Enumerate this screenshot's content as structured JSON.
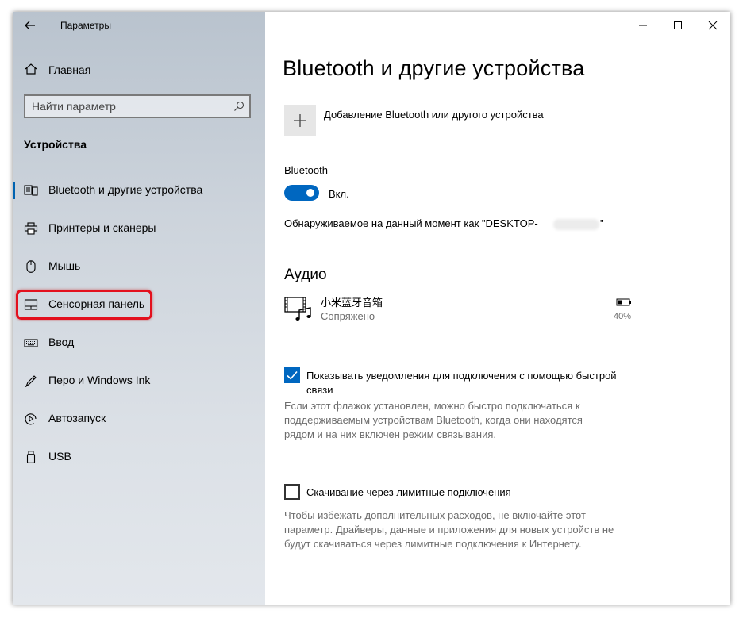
{
  "window": {
    "title": "Параметры"
  },
  "sidebar": {
    "home_label": "Главная",
    "search_placeholder": "Найти параметр",
    "section_title": "Устройства",
    "items": [
      {
        "label": "Bluetooth и другие устройства",
        "icon": "bluetooth-devices-icon",
        "selected": true
      },
      {
        "label": "Принтеры и сканеры",
        "icon": "printer-icon"
      },
      {
        "label": "Мышь",
        "icon": "mouse-icon"
      },
      {
        "label": "Сенсорная панель",
        "icon": "touchpad-icon",
        "highlighted": true
      },
      {
        "label": "Ввод",
        "icon": "keyboard-icon"
      },
      {
        "label": "Перо и Windows Ink",
        "icon": "pen-icon"
      },
      {
        "label": "Автозапуск",
        "icon": "autoplay-icon"
      },
      {
        "label": "USB",
        "icon": "usb-icon"
      }
    ]
  },
  "main": {
    "title": "Bluetooth и другие устройства",
    "add_device_label": "Добавление Bluetooth или другого устройства",
    "bluetooth_label": "Bluetooth",
    "bluetooth_state": "Вкл.",
    "discoverable_prefix": "Обнаруживаемое на данный момент как \"DESKTOP-",
    "discoverable_suffix": "\"",
    "audio_heading": "Аудио",
    "audio_device": {
      "name": "小米蓝牙音箱",
      "status": "Сопряжено",
      "battery": "40%"
    },
    "swift_pair": {
      "checked": true,
      "label_line1": "Показывать уведомления для подключения с помощью быстрой",
      "label_line2": "связи",
      "desc_line1": "Если этот флажок установлен, можно быстро подключаться к",
      "desc_line2": "поддерживаемым устройствам Bluetooth, когда они находятся",
      "desc_line3": "рядом и на них включен режим связывания."
    },
    "metered": {
      "checked": false,
      "label": "Скачивание через лимитные подключения",
      "desc_line1": "Чтобы избежать дополнительных расходов, не включайте этот",
      "desc_line2": "параметр. Драйверы, данные и приложения для новых устройств не",
      "desc_line3": "будут скачиваться через лимитные подключения к Интернету."
    }
  },
  "colors": {
    "accent": "#0067c0",
    "highlight_border": "#e3101d"
  }
}
